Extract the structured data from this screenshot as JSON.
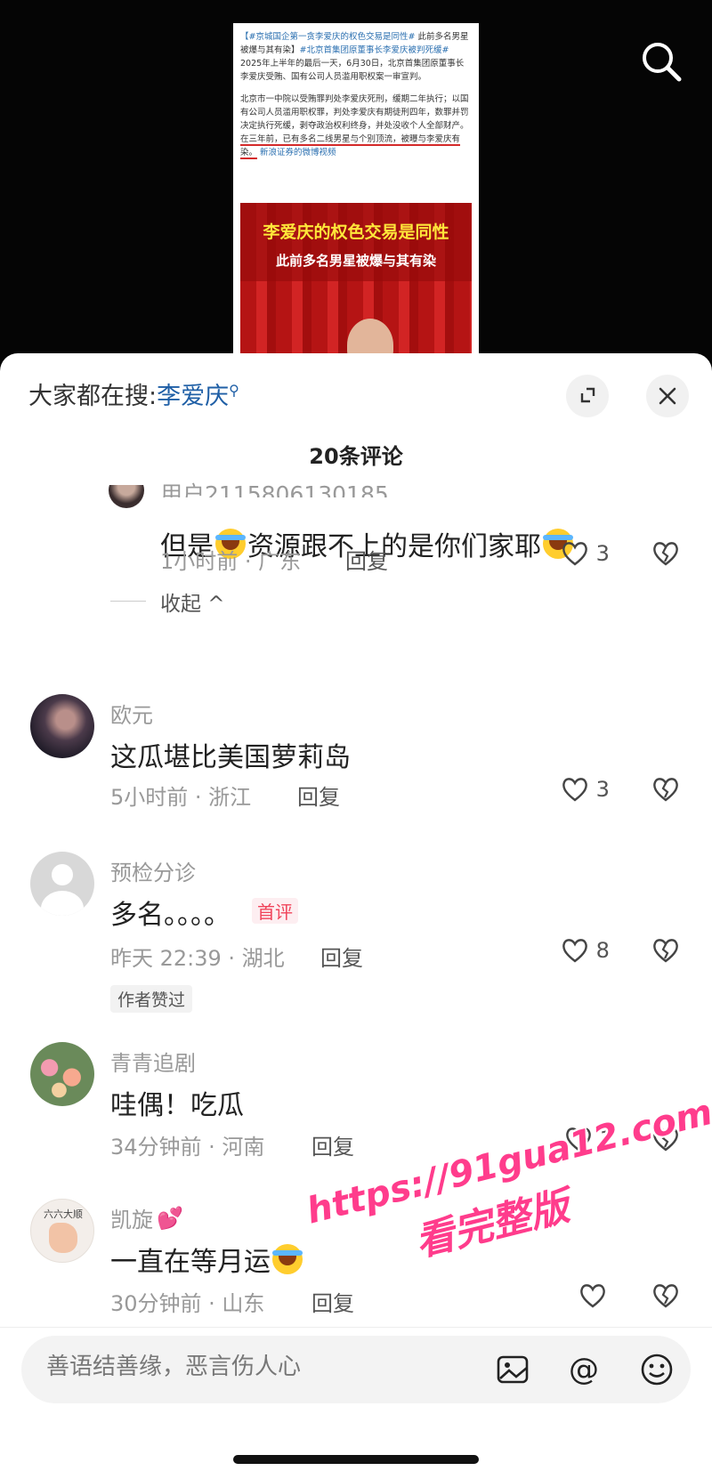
{
  "video": {
    "article_lines": [
      {
        "tag": "【#京城国企第一贪李爱庆的权色交易是同性#",
        "text": " 此前多名男星被爆与其有染】",
        "tag2": "#北京首集团原董事长李爱庆被判死缓#",
        "text2": " 2025年上半年的最后一天，6月30日，北京首集团原董事长李爱庆受贿、国有公司人员滥用职权案一审宣判。"
      },
      {
        "text": "北京市一中院以受贿罪判处李爱庆死刑，缓期二年执行；以国有公司人员滥用职权罪，判处李爱庆有期徒刑四年，数罪并罚决定执行死缓，剥夺政治权利终身，并处没收个人全部财产。",
        "underlined": "在三年前，已有多名二线男星与个别顶流，被曝与李爱庆有染。",
        "source": "新浪证券的微博视频"
      }
    ],
    "poster_title": "李爱庆的权色交易是同性",
    "poster_subtitle": "此前多名男星被爆与其有染",
    "search_icon": "search-icon"
  },
  "sheet": {
    "hot_search_label": "大家都在搜:",
    "hot_search_keyword": "李爱庆",
    "comment_count_title": "20条评论",
    "expand_icon": "expand-icon",
    "close_icon": "close-icon"
  },
  "reply": {
    "user": "用户2115806130185",
    "text_a": "但是",
    "text_b": "资源跟不上的是你们家耶",
    "meta": "1小时前 · 广东",
    "reply_label": "回复",
    "likes": "3",
    "collapse_label": "收起 ^"
  },
  "comments": [
    {
      "user": "欧元",
      "text": "这瓜堪比美国萝莉岛",
      "meta": "5小时前 · 浙江",
      "reply_label": "回复",
      "likes": "3"
    },
    {
      "user": "预检分诊",
      "text": "多名。。。。",
      "badge": "首评",
      "meta": "昨天 22:39 · 湖北",
      "reply_label": "回复",
      "likes": "8",
      "author_liked": "作者赞过"
    },
    {
      "user": "青青追剧",
      "text": "哇偶！吃瓜",
      "meta": "34分钟前 · 河南",
      "reply_label": "回复",
      "likes": "1"
    },
    {
      "user": "凯旋",
      "user_suffix": "💕",
      "avatar_label": "六六大顺",
      "text": "一直在等月运",
      "meta": "30分钟前 · 山东",
      "reply_label": "回复",
      "likes": ""
    }
  ],
  "input": {
    "placeholder": "善语结善缘，恶言伤人心",
    "image_icon": "image-icon",
    "at_icon": "at-icon",
    "emoji_icon": "emoji-icon"
  },
  "watermark": {
    "url": "https://91gua12.com",
    "sub": "看完整版"
  },
  "colors": {
    "keyword": "#1f5fa6",
    "badge": "#f0445b",
    "watermark": "#ff3c8c"
  }
}
